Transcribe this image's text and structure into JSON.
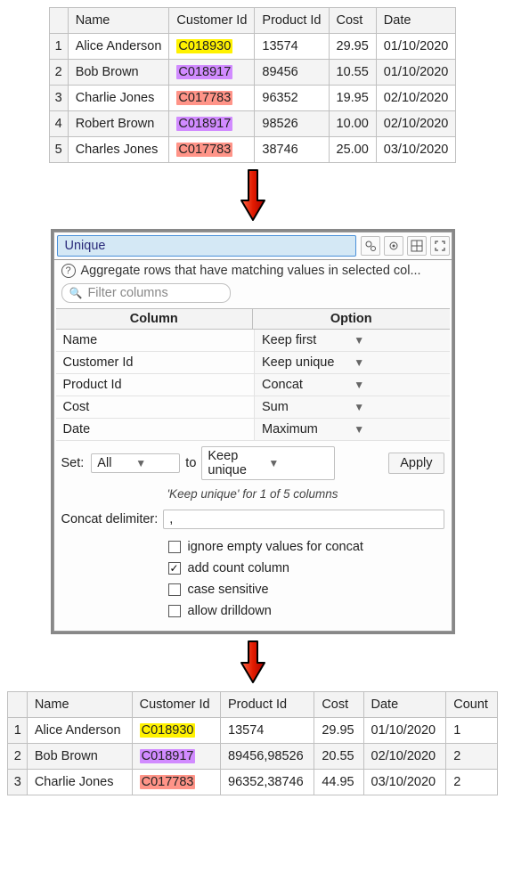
{
  "top_table": {
    "headers": [
      "",
      "Name",
      "Customer Id",
      "Product Id",
      "Cost",
      "Date"
    ],
    "rows": [
      {
        "n": "1",
        "name": "Alice Anderson",
        "cid": "C018930",
        "hl": "y",
        "pid": "13574",
        "cost": "29.95",
        "date": "01/10/2020"
      },
      {
        "n": "2",
        "name": "Bob Brown",
        "cid": "C018917",
        "hl": "p",
        "pid": "89456",
        "cost": "10.55",
        "date": "01/10/2020"
      },
      {
        "n": "3",
        "name": "Charlie Jones",
        "cid": "C017783",
        "hl": "r",
        "pid": "96352",
        "cost": "19.95",
        "date": "02/10/2020"
      },
      {
        "n": "4",
        "name": "Robert Brown",
        "cid": "C018917",
        "hl": "p",
        "pid": "98526",
        "cost": "10.00",
        "date": "02/10/2020"
      },
      {
        "n": "5",
        "name": "Charles Jones",
        "cid": "C017783",
        "hl": "r",
        "pid": "38746",
        "cost": "25.00",
        "date": "03/10/2020"
      }
    ]
  },
  "panel": {
    "title": "Unique",
    "desc": "Aggregate rows that have matching values in selected col...",
    "filter_placeholder": "Filter columns",
    "head_col": "Column",
    "head_opt": "Option",
    "rows": [
      {
        "col": "Name",
        "opt": "Keep first"
      },
      {
        "col": "Customer Id",
        "opt": "Keep unique"
      },
      {
        "col": "Product Id",
        "opt": "Concat"
      },
      {
        "col": "Cost",
        "opt": "Sum"
      },
      {
        "col": "Date",
        "opt": "Maximum"
      }
    ],
    "set_label": "Set:",
    "set_value": "All",
    "to_label": "to",
    "to_value": "Keep unique",
    "apply": "Apply",
    "status": "'Keep unique' for 1 of 5 columns",
    "concat_label": "Concat delimiter:",
    "concat_value": ",",
    "checks": [
      {
        "label": "ignore empty values for concat",
        "checked": false
      },
      {
        "label": "add count column",
        "checked": true
      },
      {
        "label": "case sensitive",
        "checked": false
      },
      {
        "label": "allow drilldown",
        "checked": false
      }
    ]
  },
  "bottom_table": {
    "headers": [
      "",
      "Name",
      "Customer Id",
      "Product Id",
      "Cost",
      "Date",
      "Count"
    ],
    "rows": [
      {
        "n": "1",
        "name": "Alice Anderson",
        "cid": "C018930",
        "hl": "y",
        "pid": "13574",
        "cost": "29.95",
        "date": "01/10/2020",
        "count": "1"
      },
      {
        "n": "2",
        "name": "Bob Brown",
        "cid": "C018917",
        "hl": "p",
        "pid": "89456,98526",
        "cost": "20.55",
        "date": "02/10/2020",
        "count": "2"
      },
      {
        "n": "3",
        "name": "Charlie Jones",
        "cid": "C017783",
        "hl": "r",
        "pid": "96352,38746",
        "cost": "44.95",
        "date": "03/10/2020",
        "count": "2"
      }
    ]
  }
}
